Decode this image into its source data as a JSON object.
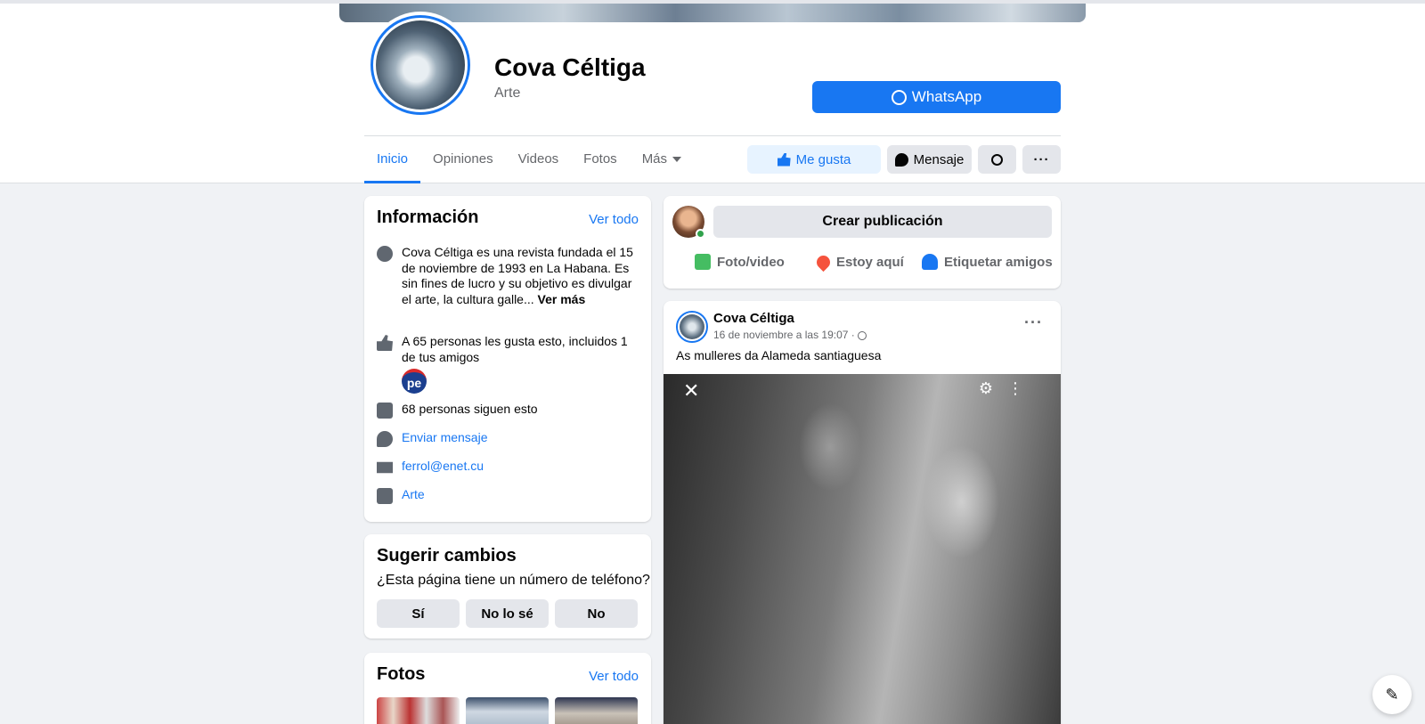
{
  "page": {
    "name": "Cova Céltiga",
    "category": "Arte",
    "whatsapp_label": "WhatsApp"
  },
  "tabs": [
    {
      "label": "Inicio"
    },
    {
      "label": "Opiniones"
    },
    {
      "label": "Videos"
    },
    {
      "label": "Fotos"
    },
    {
      "label": "Más"
    }
  ],
  "actions": {
    "like_label": "Me gusta",
    "message_label": "Mensaje"
  },
  "info": {
    "title": "Información",
    "see_all": "Ver todo",
    "description": "Cova Céltiga es una revista fundada el 15 de noviembre de 1993 en La Habana. Es sin fines de lucro y su objetivo es divulgar el arte, la cultura galle...",
    "see_more": "Ver más",
    "likes_text": "A 65 personas les gusta esto, incluidos 1 de tus amigos",
    "friend_badge": "pe",
    "followers_text": "68 personas siguen esto",
    "send_message": "Enviar mensaje",
    "email": "ferrol@enet.cu",
    "category_link": "Arte"
  },
  "suggest": {
    "title": "Sugerir cambios",
    "question": "¿Esta página tiene un número de teléfono?",
    "yes": "Sí",
    "dont_know": "No lo sé",
    "no": "No"
  },
  "photos": {
    "title": "Fotos",
    "see_all": "Ver todo"
  },
  "composer": {
    "create_label": "Crear publicación",
    "photo_video": "Foto/video",
    "check_in": "Estoy aquí",
    "tag_friends": "Etiquetar amigos"
  },
  "post": {
    "author": "Cova Céltiga",
    "timestamp": "16 de noviembre a las 19:07 ·",
    "text": "As mulleres da Alameda santiaguesa"
  },
  "colors": {
    "accent": "#1877f2",
    "background": "#f0f2f5",
    "online": "#31a24c"
  }
}
